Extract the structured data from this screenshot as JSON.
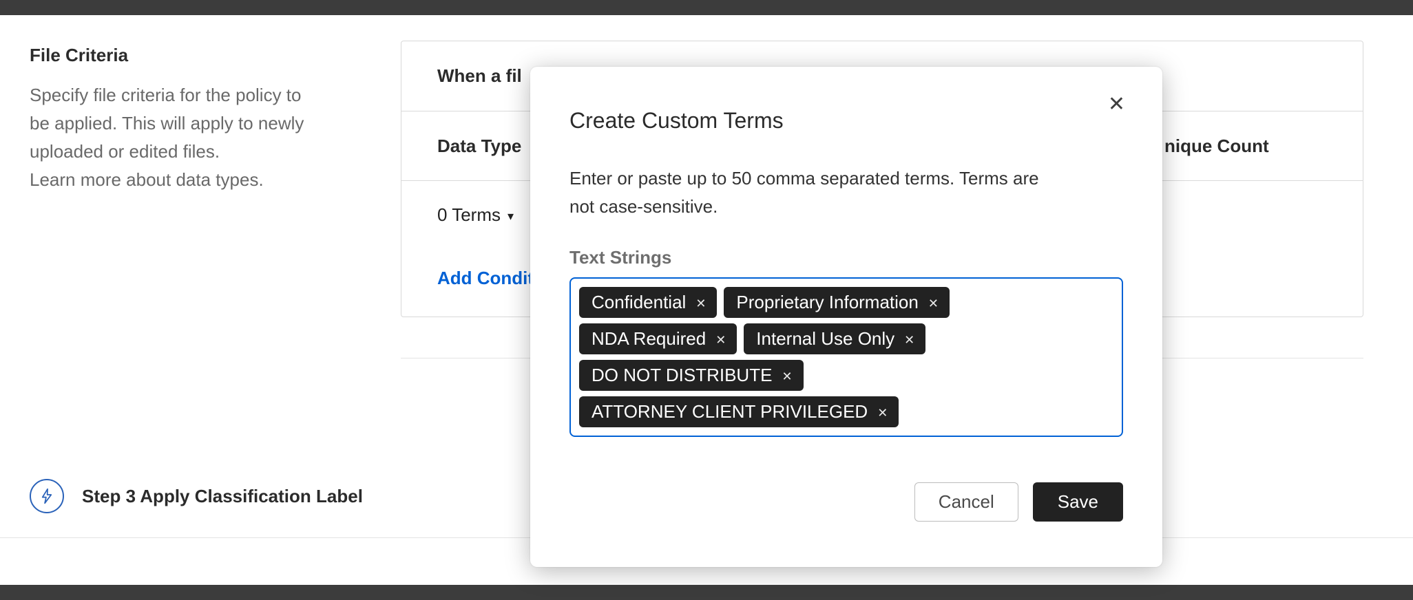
{
  "page": {
    "file_criteria": {
      "title": "File Criteria",
      "lines": [
        "Specify file criteria for the policy to",
        "be applied. This will apply to newly",
        "uploaded or edited files."
      ],
      "learn_more": "Learn more about data types."
    },
    "panel": {
      "when_text": "When a fil",
      "data_type_label": "Data Type",
      "unique_count_label": "nique Count",
      "terms_dropdown_label": "0 Terms",
      "caret_icon": "▾",
      "add_condition_label": "Add Condit"
    },
    "step3": {
      "label": "Step 3 Apply Classification Label",
      "icon": "lightning-bolt"
    }
  },
  "modal": {
    "title": "Create Custom Terms",
    "close_icon": "✕",
    "description_lines": [
      "Enter or paste up to 50 comma separated terms. Terms are",
      "not case-sensitive."
    ],
    "field_label": "Text Strings",
    "terms": [
      "Confidential",
      "Proprietary Information",
      "NDA Required",
      "Internal Use Only",
      "DO NOT DISTRIBUTE",
      "ATTORNEY CLIENT PRIVILEGED"
    ],
    "remove_icon": "✕",
    "cancel_label": "Cancel",
    "save_label": "Save"
  },
  "colors": {
    "accent_blue": "#0061d5",
    "step_icon_blue": "#2a62b9",
    "chip_bg": "#222222",
    "save_button_bg": "#222222",
    "dark_bar": "#3c3c3c",
    "focus_border": "#0061d5"
  }
}
